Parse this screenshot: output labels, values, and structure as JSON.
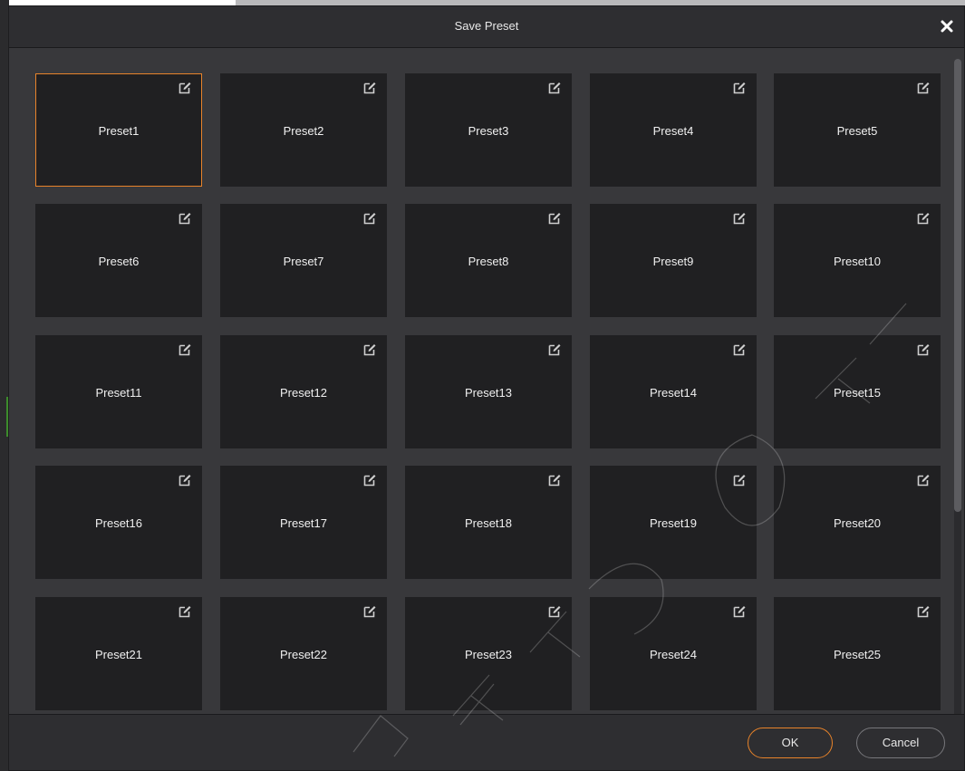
{
  "dialog": {
    "title": "Save Preset",
    "close_icon": "close-icon"
  },
  "presets": [
    {
      "label": "Preset1",
      "selected": true
    },
    {
      "label": "Preset2",
      "selected": false
    },
    {
      "label": "Preset3",
      "selected": false
    },
    {
      "label": "Preset4",
      "selected": false
    },
    {
      "label": "Preset5",
      "selected": false
    },
    {
      "label": "Preset6",
      "selected": false
    },
    {
      "label": "Preset7",
      "selected": false
    },
    {
      "label": "Preset8",
      "selected": false
    },
    {
      "label": "Preset9",
      "selected": false
    },
    {
      "label": "Preset10",
      "selected": false
    },
    {
      "label": "Preset11",
      "selected": false
    },
    {
      "label": "Preset12",
      "selected": false
    },
    {
      "label": "Preset13",
      "selected": false
    },
    {
      "label": "Preset14",
      "selected": false
    },
    {
      "label": "Preset15",
      "selected": false
    },
    {
      "label": "Preset16",
      "selected": false
    },
    {
      "label": "Preset17",
      "selected": false
    },
    {
      "label": "Preset18",
      "selected": false
    },
    {
      "label": "Preset19",
      "selected": false
    },
    {
      "label": "Preset20",
      "selected": false
    },
    {
      "label": "Preset21",
      "selected": false
    },
    {
      "label": "Preset22",
      "selected": false
    },
    {
      "label": "Preset23",
      "selected": false
    },
    {
      "label": "Preset24",
      "selected": false
    },
    {
      "label": "Preset25",
      "selected": false
    }
  ],
  "tile_icon": "edit-icon",
  "footer": {
    "ok_label": "OK",
    "cancel_label": "Cancel"
  },
  "colors": {
    "accent": "#e8832a",
    "dialog_bg": "#38383b",
    "tile_bg": "#202022"
  }
}
